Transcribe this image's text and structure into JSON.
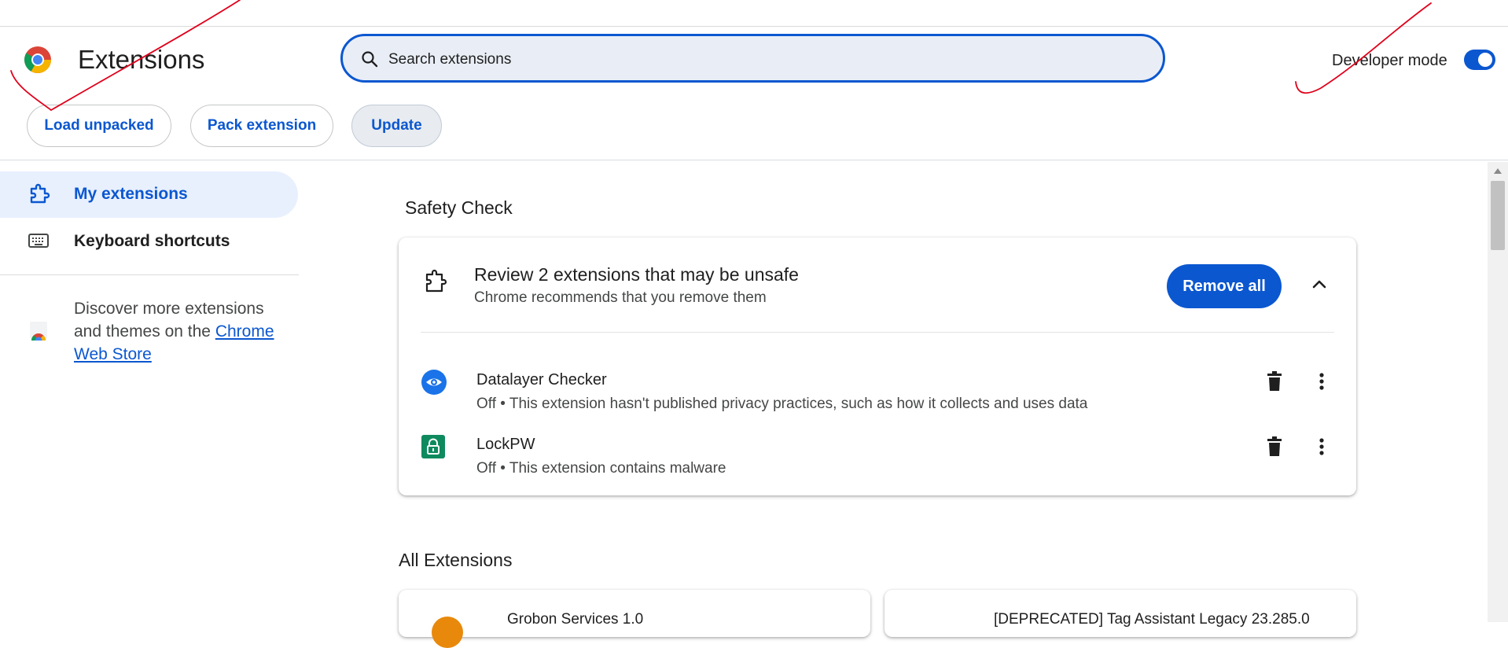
{
  "app": {
    "title": "Extensions"
  },
  "search": {
    "placeholder": "Search extensions"
  },
  "developer_mode": {
    "label": "Developer mode",
    "enabled": true
  },
  "toolbar": {
    "load_unpacked": "Load unpacked",
    "pack_extension": "Pack extension",
    "update": "Update"
  },
  "sidebar": {
    "items": [
      {
        "label": "My extensions",
        "icon": "puzzle-icon",
        "active": true
      },
      {
        "label": "Keyboard shortcuts",
        "icon": "keyboard-icon",
        "active": false
      }
    ],
    "discover_text": "Discover more extensions and themes on the",
    "discover_link": "Chrome Web Store"
  },
  "safety_check": {
    "section_title": "Safety Check",
    "card_title": "Review 2 extensions that may be unsafe",
    "card_subtitle": "Chrome recommends that you remove them",
    "remove_all": "Remove all",
    "extensions": [
      {
        "name": "Datalayer Checker",
        "description": "Off • This extension hasn't published privacy practices, such as how it collects and uses data",
        "icon": "eye-icon",
        "icon_color": "#1a73e8"
      },
      {
        "name": "LockPW",
        "description": "Off • This extension contains malware",
        "icon": "lock-icon",
        "icon_color": "#0f8a5f"
      }
    ]
  },
  "all_extensions": {
    "section_title": "All Extensions",
    "cards": [
      {
        "name": "Grobon Services  1.0"
      },
      {
        "name": "[DEPRECATED] Tag Assistant Legacy  23.285.0"
      }
    ]
  },
  "colors": {
    "accent": "#0b57d0",
    "annotation": "#e0001b"
  }
}
